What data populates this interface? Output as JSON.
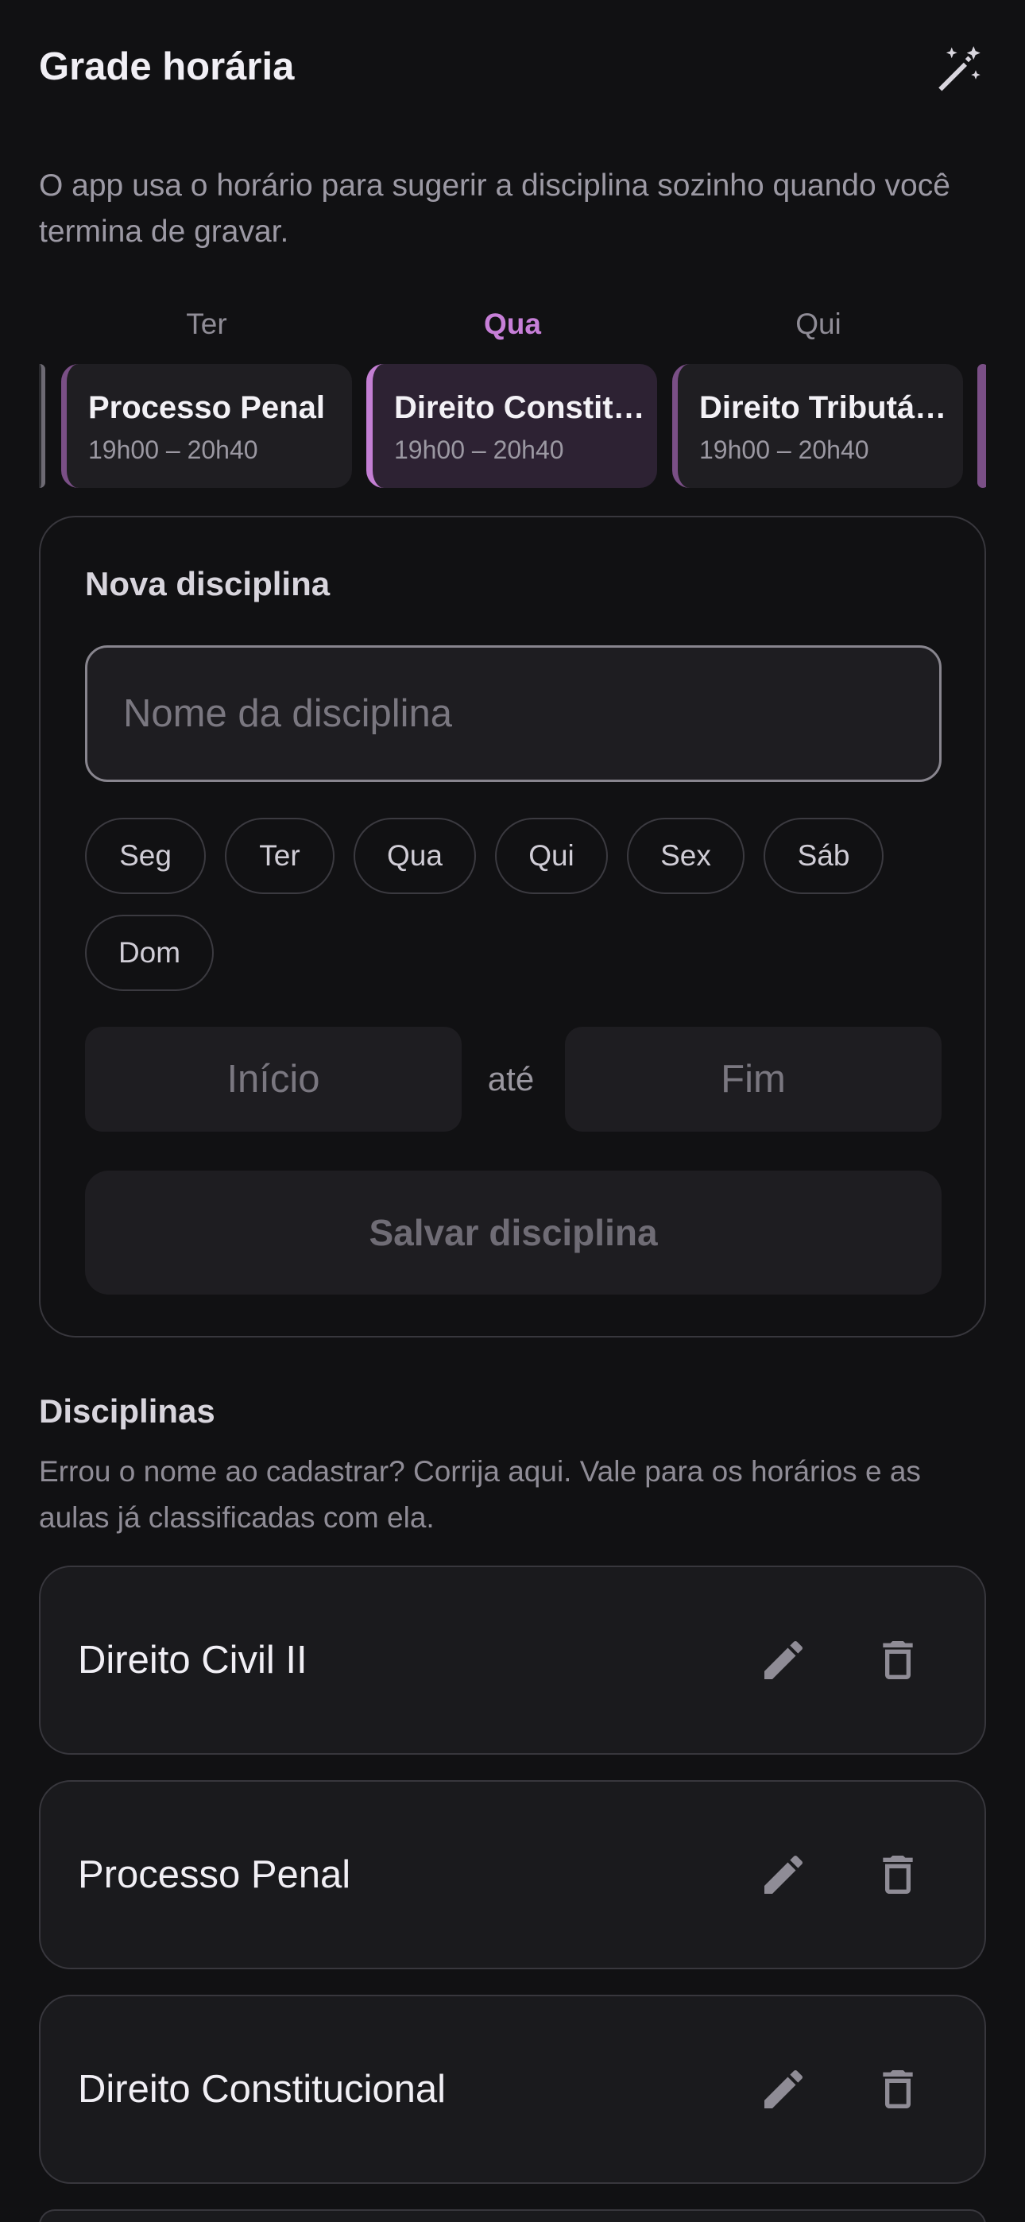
{
  "header": {
    "title": "Grade horária",
    "magic_icon": "magic-wand-icon"
  },
  "intro": "O app usa o horário para sugerir a disciplina sozinho quando você termina de gravar.",
  "schedule": {
    "days": [
      "Ter",
      "Qua",
      "Qui"
    ],
    "active_day": "Qua",
    "cards": [
      {
        "title": "Processo Penal",
        "time": "19h00 – 20h40",
        "active": false
      },
      {
        "title": "Direito Constitucional",
        "time": "19h00 – 20h40",
        "active": true
      },
      {
        "title": "Direito Tributário",
        "time": "19h00 – 20h40",
        "active": false
      }
    ]
  },
  "form": {
    "heading": "Nova disciplina",
    "name_placeholder": "Nome da disciplina",
    "name_value": "",
    "weekdays": [
      "Seg",
      "Ter",
      "Qua",
      "Qui",
      "Sex",
      "Sáb",
      "Dom"
    ],
    "start_placeholder": "Início",
    "separator": "até",
    "end_placeholder": "Fim",
    "save_label": "Salvar disciplina"
  },
  "disciplines": {
    "heading": "Disciplinas",
    "description": "Errou o nome ao cadastrar? Corrija aqui. Vale para os horários e as aulas já classificadas com ela.",
    "items": [
      {
        "name": "Direito Civil II"
      },
      {
        "name": "Processo Penal"
      },
      {
        "name": "Direito Constitucional"
      }
    ],
    "edit_icon": "pencil-icon",
    "delete_icon": "trash-icon"
  },
  "colors": {
    "background": "#111113",
    "accent": "#c77fd8",
    "surface": "#1e1d21"
  }
}
